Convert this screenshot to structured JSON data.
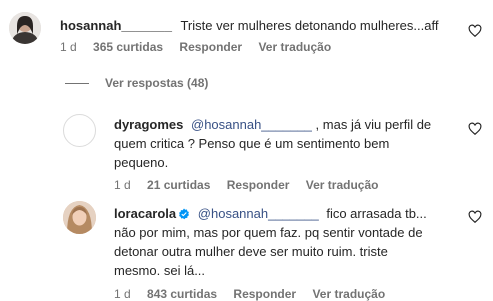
{
  "comments": [
    {
      "username": "hosannah_______",
      "text": "Triste ver mulheres detonando mulheres...aff",
      "age": "1 d",
      "likes": "365 curtidas",
      "reply_label": "Responder",
      "translate_label": "Ver tradução"
    }
  ],
  "view_replies": "Ver respostas (48)",
  "replies": [
    {
      "username": "dyragomes",
      "mention": "@hosannah_______",
      "text_line1": ", mas já viu perfil de",
      "text_line2": "quem critica ? Penso que é um sentimento bem",
      "text_line3": "pequeno.",
      "age": "1 d",
      "likes": "21 curtidas",
      "reply_label": "Responder",
      "translate_label": "Ver tradução"
    },
    {
      "username": "loracarola",
      "mention": "@hosannah_______",
      "text_line1": "fico arrasada tb...",
      "text_line2": "não por mim, mas por quem faz. pq sentir vontade de",
      "text_line3": "detonar outra mulher deve ser muito ruim. triste",
      "text_line4": "mesmo. sei lá...",
      "age": "1 d",
      "likes": "843 curtidas",
      "reply_label": "Responder",
      "translate_label": "Ver tradução"
    }
  ],
  "icons": {
    "like": "heart-outline-icon",
    "verified": "verified-badge-icon"
  },
  "colors": {
    "mention": "#385185",
    "meta": "#737373",
    "verified": "#0095f6"
  }
}
